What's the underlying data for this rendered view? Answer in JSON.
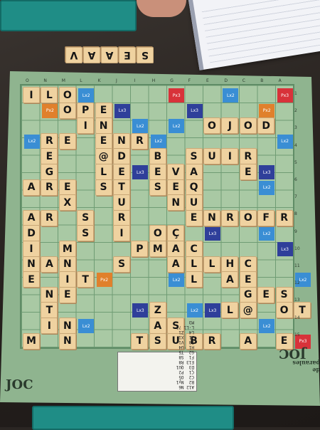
{
  "scene": {
    "description_words": [],
    "brand": {
      "name": "JOC",
      "sub": "de paraules"
    },
    "loose_word": [
      "S",
      "E",
      "A",
      "A",
      "V"
    ],
    "legend_text": "A12 N6\nB2  Ny1\nC2  O5\nÇ1  P2\nD3  QU1\nE13 R8\nF1  S8\nG2  T5\nH1  U4\nI8  V1\nJ1  X1\nL4  Z1\nL·L1 ?2\nM3"
  },
  "tiles": [
    {
      "t": "I",
      "r": 0,
      "c": 0
    },
    {
      "t": "L",
      "r": 0,
      "c": 1
    },
    {
      "t": "O",
      "r": 0,
      "c": 2
    },
    {
      "t": "O",
      "r": 1,
      "c": 2
    },
    {
      "t": "P",
      "r": 1,
      "c": 3
    },
    {
      "t": "E",
      "r": 1,
      "c": 4
    },
    {
      "t": "N",
      "r": 2,
      "c": 4
    },
    {
      "t": "I",
      "r": 2,
      "c": 3
    },
    {
      "t": "R",
      "r": 3,
      "c": 1
    },
    {
      "t": "E",
      "r": 3,
      "c": 2
    },
    {
      "t": "E",
      "r": 3,
      "c": 4
    },
    {
      "t": "N",
      "r": 3,
      "c": 5
    },
    {
      "t": "R",
      "r": 3,
      "c": 6
    },
    {
      "t": "O",
      "r": 2,
      "c": 10
    },
    {
      "t": "J",
      "r": 2,
      "c": 11
    },
    {
      "t": "O",
      "r": 2,
      "c": 12
    },
    {
      "t": "D",
      "r": 2,
      "c": 13
    },
    {
      "t": "E",
      "r": 4,
      "c": 1
    },
    {
      "t": "@",
      "r": 4,
      "c": 4
    },
    {
      "t": "D",
      "r": 4,
      "c": 5
    },
    {
      "t": "B",
      "r": 4,
      "c": 7
    },
    {
      "t": "S",
      "r": 4,
      "c": 9
    },
    {
      "t": "U",
      "r": 4,
      "c": 10
    },
    {
      "t": "I",
      "r": 4,
      "c": 11
    },
    {
      "t": "R",
      "r": 4,
      "c": 12
    },
    {
      "t": "G",
      "r": 5,
      "c": 1
    },
    {
      "t": "L",
      "r": 5,
      "c": 4
    },
    {
      "t": "E",
      "r": 5,
      "c": 5
    },
    {
      "t": "E",
      "r": 5,
      "c": 7
    },
    {
      "t": "V",
      "r": 5,
      "c": 8
    },
    {
      "t": "A",
      "r": 5,
      "c": 9
    },
    {
      "t": "E",
      "r": 5,
      "c": 12
    },
    {
      "t": "A",
      "r": 6,
      "c": 0
    },
    {
      "t": "R",
      "r": 6,
      "c": 1
    },
    {
      "t": "E",
      "r": 6,
      "c": 2
    },
    {
      "t": "S",
      "r": 6,
      "c": 4
    },
    {
      "t": "T",
      "r": 6,
      "c": 5
    },
    {
      "t": "S",
      "r": 6,
      "c": 7
    },
    {
      "t": "E",
      "r": 6,
      "c": 8
    },
    {
      "t": "Q",
      "r": 6,
      "c": 9
    },
    {
      "t": "X",
      "r": 7,
      "c": 2
    },
    {
      "t": "U",
      "r": 7,
      "c": 5
    },
    {
      "t": "N",
      "r": 7,
      "c": 8
    },
    {
      "t": "U",
      "r": 7,
      "c": 9
    },
    {
      "t": "A",
      "r": 8,
      "c": 0
    },
    {
      "t": "R",
      "r": 8,
      "c": 1
    },
    {
      "t": "S",
      "r": 8,
      "c": 3
    },
    {
      "t": "R",
      "r": 8,
      "c": 5
    },
    {
      "t": "E",
      "r": 8,
      "c": 9
    },
    {
      "t": "N",
      "r": 8,
      "c": 10
    },
    {
      "t": "R",
      "r": 8,
      "c": 11
    },
    {
      "t": "O",
      "r": 8,
      "c": 12
    },
    {
      "t": "F",
      "r": 8,
      "c": 13
    },
    {
      "t": "R",
      "r": 8,
      "c": 14
    },
    {
      "t": "D",
      "r": 9,
      "c": 0
    },
    {
      "t": "S",
      "r": 9,
      "c": 3
    },
    {
      "t": "I",
      "r": 9,
      "c": 5
    },
    {
      "t": "O",
      "r": 9,
      "c": 7
    },
    {
      "t": "Ç",
      "r": 9,
      "c": 8
    },
    {
      "t": "I",
      "r": 10,
      "c": 0
    },
    {
      "t": "M",
      "r": 10,
      "c": 2
    },
    {
      "t": "P",
      "r": 10,
      "c": 6
    },
    {
      "t": "M",
      "r": 10,
      "c": 7
    },
    {
      "t": "A",
      "r": 10,
      "c": 8
    },
    {
      "t": "C",
      "r": 10,
      "c": 9
    },
    {
      "t": "N",
      "r": 11,
      "c": 0
    },
    {
      "t": "A",
      "r": 11,
      "c": 1
    },
    {
      "t": "N",
      "r": 11,
      "c": 2
    },
    {
      "t": "S",
      "r": 11,
      "c": 5
    },
    {
      "t": "A",
      "r": 11,
      "c": 8
    },
    {
      "t": "L",
      "r": 11,
      "c": 9
    },
    {
      "t": "L",
      "r": 11,
      "c": 10
    },
    {
      "t": "H",
      "r": 11,
      "c": 11
    },
    {
      "t": "C",
      "r": 11,
      "c": 12
    },
    {
      "t": "E",
      "r": 12,
      "c": 0
    },
    {
      "t": "I",
      "r": 12,
      "c": 2
    },
    {
      "t": "T",
      "r": 12,
      "c": 3
    },
    {
      "t": "L",
      "r": 12,
      "c": 9
    },
    {
      "t": "A",
      "r": 12,
      "c": 11
    },
    {
      "t": "E",
      "r": 12,
      "c": 12
    },
    {
      "t": "N",
      "r": 13,
      "c": 1
    },
    {
      "t": "E",
      "r": 13,
      "c": 2
    },
    {
      "t": "G",
      "r": 13,
      "c": 12
    },
    {
      "t": "E",
      "r": 13,
      "c": 13
    },
    {
      "t": "S",
      "r": 13,
      "c": 14
    },
    {
      "t": "T",
      "r": 14,
      "c": 1
    },
    {
      "t": "Z",
      "r": 14,
      "c": 7
    },
    {
      "t": "L",
      "r": 14,
      "c": 11
    },
    {
      "t": "@",
      "r": 14,
      "c": 12
    },
    {
      "t": "O",
      "r": 14,
      "c": 14
    },
    {
      "t": "T",
      "r": 14,
      "c": 15
    },
    {
      "t": "I",
      "r": 15,
      "c": 1
    },
    {
      "t": "N",
      "r": 15,
      "c": 2
    },
    {
      "t": "A",
      "r": 15,
      "c": 7
    },
    {
      "t": "S",
      "r": 15,
      "c": 8
    },
    {
      "t": "N",
      "r": 16,
      "c": 2
    },
    {
      "t": "M",
      "r": 16,
      "c": 0
    },
    {
      "t": "T",
      "r": 16,
      "c": 6
    },
    {
      "t": "S",
      "r": 16,
      "c": 7
    },
    {
      "t": "U",
      "r": 16,
      "c": 8
    },
    {
      "t": "B",
      "r": 16,
      "c": 9
    },
    {
      "t": "R",
      "r": 16,
      "c": 10
    },
    {
      "t": "A",
      "r": 16,
      "c": 12
    },
    {
      "t": "E",
      "r": 16,
      "c": 14
    }
  ],
  "bonus": [
    {
      "k": "px3",
      "txt": "Px3",
      "r": 0,
      "c": 8
    },
    {
      "k": "px3",
      "txt": "Px3",
      "r": 0,
      "c": 14
    },
    {
      "k": "lx2",
      "txt": "Lx2",
      "r": 0,
      "c": 3
    },
    {
      "k": "lx2",
      "txt": "Lx2",
      "r": 0,
      "c": 11
    },
    {
      "k": "px2",
      "txt": "Px2",
      "r": 1,
      "c": 1
    },
    {
      "k": "lx3",
      "txt": "Lx3",
      "r": 1,
      "c": 5
    },
    {
      "k": "lx3",
      "txt": "Lx3",
      "r": 1,
      "c": 9
    },
    {
      "k": "px2",
      "txt": "Px2",
      "r": 1,
      "c": 13
    },
    {
      "k": "lx2",
      "txt": "Lx2",
      "r": 2,
      "c": 6
    },
    {
      "k": "lx2",
      "txt": "Lx2",
      "r": 2,
      "c": 8
    },
    {
      "k": "lx2",
      "txt": "Lx2",
      "r": 3,
      "c": 0
    },
    {
      "k": "lx2",
      "txt": "Lx2",
      "r": 3,
      "c": 7
    },
    {
      "k": "lx2",
      "txt": "Lx2",
      "r": 3,
      "c": 14
    },
    {
      "k": "lx3",
      "txt": "Lx3",
      "r": 5,
      "c": 13
    },
    {
      "k": "lx3",
      "txt": "Lx3",
      "r": 5,
      "c": 6
    },
    {
      "k": "lx2",
      "txt": "Lx2",
      "r": 6,
      "c": 13
    },
    {
      "k": "lx2",
      "txt": "Lx2",
      "r": 8,
      "c": 3
    },
    {
      "k": "lx2",
      "txt": "Lx2",
      "r": 9,
      "c": 13
    },
    {
      "k": "lx3",
      "txt": "Lx3",
      "r": 9,
      "c": 10
    },
    {
      "k": "lx3",
      "txt": "Lx3",
      "r": 10,
      "c": 14
    },
    {
      "k": "px2",
      "txt": "Px2",
      "r": 12,
      "c": 4
    },
    {
      "k": "lx2",
      "txt": "Lx2",
      "r": 12,
      "c": 8
    },
    {
      "k": "lx2",
      "txt": "Lx2",
      "r": 12,
      "c": 15
    },
    {
      "k": "lx3",
      "txt": "Lx3",
      "r": 14,
      "c": 6
    },
    {
      "k": "lx2",
      "txt": "Lx2",
      "r": 14,
      "c": 9
    },
    {
      "k": "lx3",
      "txt": "Lx3",
      "r": 14,
      "c": 10
    },
    {
      "k": "lx2",
      "txt": "Lx2",
      "r": 15,
      "c": 3
    },
    {
      "k": "lx2",
      "txt": "Lx2",
      "r": 15,
      "c": 13
    },
    {
      "k": "px3",
      "txt": "Px3",
      "r": 16,
      "c": 0
    },
    {
      "k": "px3",
      "txt": "Px3",
      "r": 16,
      "c": 15
    }
  ],
  "col_labels": [
    "O",
    "N",
    "M",
    "L",
    "K",
    "J",
    "I",
    "H",
    "G",
    "F",
    "E",
    "D",
    "C",
    "B",
    "A"
  ],
  "row_labels": [
    "1",
    "2",
    "3",
    "4",
    "5",
    "6",
    "7",
    "8",
    "9",
    "10",
    "11",
    "12",
    "13",
    "14",
    "15"
  ]
}
